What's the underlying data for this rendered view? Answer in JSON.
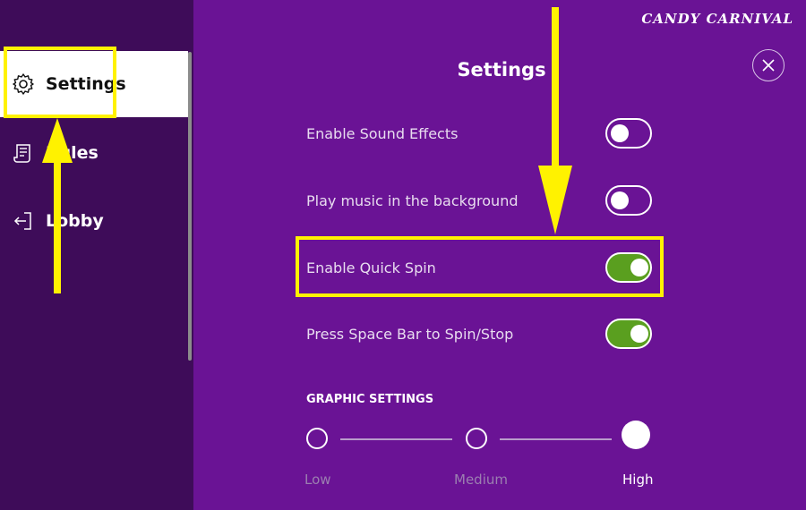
{
  "brand": "CANDY CARNIVAL",
  "sidebar": {
    "items": [
      {
        "label": "Settings",
        "icon": "gear-icon",
        "active": true
      },
      {
        "label": "Rules",
        "icon": "scroll-icon",
        "active": false
      },
      {
        "label": "Lobby",
        "icon": "exit-icon",
        "active": false
      }
    ]
  },
  "panel": {
    "title": "Settings",
    "close_icon": "close-icon",
    "settings": [
      {
        "label": "Enable Sound Effects",
        "enabled": false
      },
      {
        "label": "Play music in the background",
        "enabled": false
      },
      {
        "label": "Enable Quick Spin",
        "enabled": true
      },
      {
        "label": "Press Space Bar to Spin/Stop",
        "enabled": true
      }
    ],
    "graphics": {
      "heading": "GRAPHIC SETTINGS",
      "options": [
        "Low",
        "Medium",
        "High"
      ],
      "selected": "High"
    }
  },
  "colors": {
    "panel_bg": "#6a1395",
    "sidebar_bg": "#3e0c59",
    "highlight": "#fff200",
    "toggle_on": "#5a9f1f"
  }
}
